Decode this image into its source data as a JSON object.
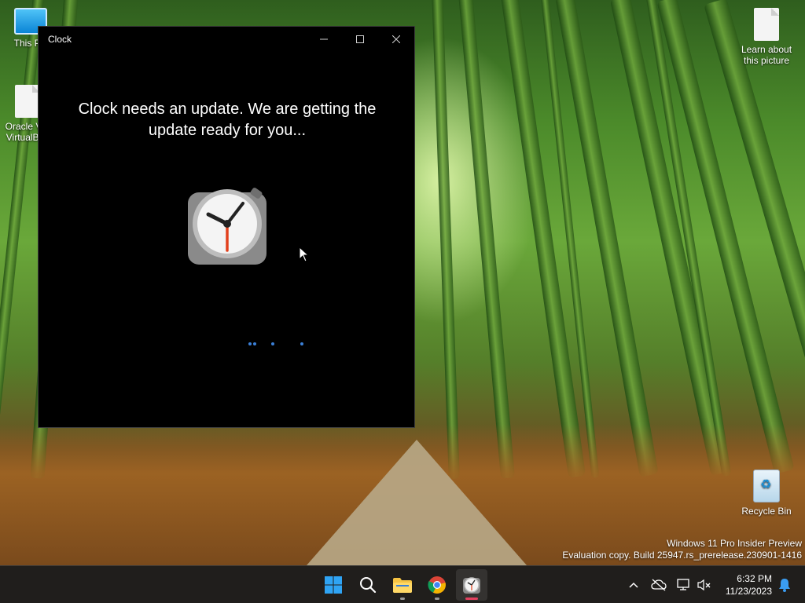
{
  "desktop": {
    "icons": [
      {
        "label": "This PC"
      },
      {
        "label": "Oracle VM VirtualBox"
      },
      {
        "label": "Learn about this picture"
      },
      {
        "label": "Recycle Bin"
      }
    ]
  },
  "window": {
    "title": "Clock",
    "message": "Clock needs an update. We are getting the update ready for you...",
    "controls": {
      "minimize": "minimize-icon",
      "maximize": "maximize-icon",
      "close": "close-icon"
    }
  },
  "watermark": {
    "line1": "Windows 11 Pro Insider Preview",
    "line2": "Evaluation copy. Build 25947.rs_prerelease.230901-1416"
  },
  "taskbar": {
    "apps": [
      {
        "name": "start",
        "icon": "windows-logo-icon"
      },
      {
        "name": "search",
        "icon": "search-icon"
      },
      {
        "name": "file-explorer",
        "icon": "folder-icon"
      },
      {
        "name": "chrome",
        "icon": "chrome-icon"
      },
      {
        "name": "clock",
        "icon": "clock-icon",
        "active": true
      }
    ],
    "tray": {
      "time": "6:32 PM",
      "date": "11/23/2023"
    }
  },
  "colors": {
    "window_bg": "#000000",
    "accent_blue": "#0078d4",
    "active_indicator": "#e4405f"
  }
}
